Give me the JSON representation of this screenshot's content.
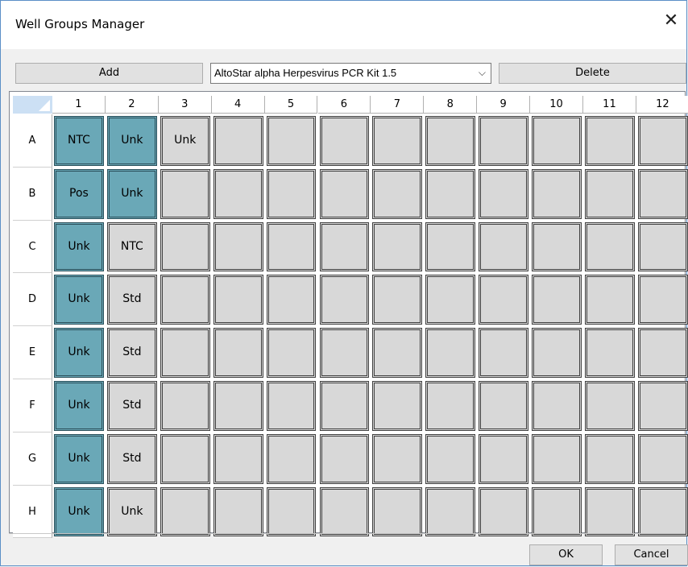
{
  "window": {
    "title": "Well Groups Manager",
    "close_glyph": "✕"
  },
  "toolbar": {
    "add_label": "Add",
    "delete_label": "Delete",
    "kit_select": {
      "value": "AltoStar alpha Herpesvirus PCR Kit 1.5",
      "chevron_glyph": "⌵"
    }
  },
  "plate": {
    "columns": [
      "1",
      "2",
      "3",
      "4",
      "5",
      "6",
      "7",
      "8",
      "9",
      "10",
      "11",
      "12"
    ],
    "rows": [
      "A",
      "B",
      "C",
      "D",
      "E",
      "F",
      "G",
      "H"
    ],
    "wells": [
      [
        {
          "label": "NTC",
          "selected": true
        },
        {
          "label": "Unk",
          "selected": true
        },
        {
          "label": "Unk",
          "selected": false
        },
        {
          "label": "",
          "selected": false
        },
        {
          "label": "",
          "selected": false
        },
        {
          "label": "",
          "selected": false
        },
        {
          "label": "",
          "selected": false
        },
        {
          "label": "",
          "selected": false
        },
        {
          "label": "",
          "selected": false
        },
        {
          "label": "",
          "selected": false
        },
        {
          "label": "",
          "selected": false
        },
        {
          "label": "",
          "selected": false
        }
      ],
      [
        {
          "label": "Pos",
          "selected": true
        },
        {
          "label": "Unk",
          "selected": true
        },
        {
          "label": "",
          "selected": false
        },
        {
          "label": "",
          "selected": false
        },
        {
          "label": "",
          "selected": false
        },
        {
          "label": "",
          "selected": false
        },
        {
          "label": "",
          "selected": false
        },
        {
          "label": "",
          "selected": false
        },
        {
          "label": "",
          "selected": false
        },
        {
          "label": "",
          "selected": false
        },
        {
          "label": "",
          "selected": false
        },
        {
          "label": "",
          "selected": false
        }
      ],
      [
        {
          "label": "Unk",
          "selected": true
        },
        {
          "label": "NTC",
          "selected": false
        },
        {
          "label": "",
          "selected": false
        },
        {
          "label": "",
          "selected": false
        },
        {
          "label": "",
          "selected": false
        },
        {
          "label": "",
          "selected": false
        },
        {
          "label": "",
          "selected": false
        },
        {
          "label": "",
          "selected": false
        },
        {
          "label": "",
          "selected": false
        },
        {
          "label": "",
          "selected": false
        },
        {
          "label": "",
          "selected": false
        },
        {
          "label": "",
          "selected": false
        }
      ],
      [
        {
          "label": "Unk",
          "selected": true
        },
        {
          "label": "Std",
          "selected": false
        },
        {
          "label": "",
          "selected": false
        },
        {
          "label": "",
          "selected": false
        },
        {
          "label": "",
          "selected": false
        },
        {
          "label": "",
          "selected": false
        },
        {
          "label": "",
          "selected": false
        },
        {
          "label": "",
          "selected": false
        },
        {
          "label": "",
          "selected": false
        },
        {
          "label": "",
          "selected": false
        },
        {
          "label": "",
          "selected": false
        },
        {
          "label": "",
          "selected": false
        }
      ],
      [
        {
          "label": "Unk",
          "selected": true
        },
        {
          "label": "Std",
          "selected": false
        },
        {
          "label": "",
          "selected": false
        },
        {
          "label": "",
          "selected": false
        },
        {
          "label": "",
          "selected": false
        },
        {
          "label": "",
          "selected": false
        },
        {
          "label": "",
          "selected": false
        },
        {
          "label": "",
          "selected": false
        },
        {
          "label": "",
          "selected": false
        },
        {
          "label": "",
          "selected": false
        },
        {
          "label": "",
          "selected": false
        },
        {
          "label": "",
          "selected": false
        }
      ],
      [
        {
          "label": "Unk",
          "selected": true
        },
        {
          "label": "Std",
          "selected": false
        },
        {
          "label": "",
          "selected": false
        },
        {
          "label": "",
          "selected": false
        },
        {
          "label": "",
          "selected": false
        },
        {
          "label": "",
          "selected": false
        },
        {
          "label": "",
          "selected": false
        },
        {
          "label": "",
          "selected": false
        },
        {
          "label": "",
          "selected": false
        },
        {
          "label": "",
          "selected": false
        },
        {
          "label": "",
          "selected": false
        },
        {
          "label": "",
          "selected": false
        }
      ],
      [
        {
          "label": "Unk",
          "selected": true
        },
        {
          "label": "Std",
          "selected": false
        },
        {
          "label": "",
          "selected": false
        },
        {
          "label": "",
          "selected": false
        },
        {
          "label": "",
          "selected": false
        },
        {
          "label": "",
          "selected": false
        },
        {
          "label": "",
          "selected": false
        },
        {
          "label": "",
          "selected": false
        },
        {
          "label": "",
          "selected": false
        },
        {
          "label": "",
          "selected": false
        },
        {
          "label": "",
          "selected": false
        },
        {
          "label": "",
          "selected": false
        }
      ],
      [
        {
          "label": "Unk",
          "selected": true
        },
        {
          "label": "Unk",
          "selected": false
        },
        {
          "label": "",
          "selected": false
        },
        {
          "label": "",
          "selected": false
        },
        {
          "label": "",
          "selected": false
        },
        {
          "label": "",
          "selected": false
        },
        {
          "label": "",
          "selected": false
        },
        {
          "label": "",
          "selected": false
        },
        {
          "label": "",
          "selected": false
        },
        {
          "label": "",
          "selected": false
        },
        {
          "label": "",
          "selected": false
        },
        {
          "label": "",
          "selected": false
        }
      ]
    ]
  },
  "footer": {
    "ok_label": "OK",
    "cancel_label": "Cancel"
  },
  "colors": {
    "selected_well": "#6aa8b7",
    "empty_well": "#d8d8d8",
    "header_corner": "#cce0f4"
  }
}
